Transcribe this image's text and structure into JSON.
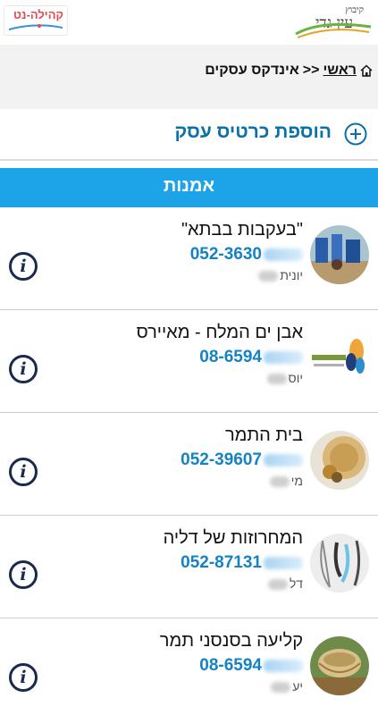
{
  "header": {
    "kibbutz_logo_small": "קיבוץ",
    "kibbutz_logo_name": "עין גדי",
    "community_logo": "קהילה-נט"
  },
  "breadcrumb": {
    "home": "ראשי",
    "separator": ">>",
    "current": "אינדקס עסקים"
  },
  "add_card": {
    "label": "הוספת כרטיס עסק"
  },
  "category": {
    "title": "אמנות"
  },
  "items": [
    {
      "name": "\"בעקבות בבתא\"",
      "phone": "052-3630",
      "contact": "יונית"
    },
    {
      "name": "אבן ים המלח - מאיירס",
      "phone": "08-6594",
      "contact": "יוס"
    },
    {
      "name": "בית התמר",
      "phone": "052-39607",
      "contact": "מי"
    },
    {
      "name": "המחרוזות של דליה",
      "phone": "052-87131",
      "contact": "דל"
    },
    {
      "name": "קליעה בסנסני תמר",
      "phone": "08-6594",
      "contact": "יע"
    }
  ],
  "info_icon_glyph": "i",
  "colors": {
    "accent": "#1da3e8",
    "link": "#0b71a6",
    "phone": "#1582c4",
    "info": "#1a2a4f"
  }
}
